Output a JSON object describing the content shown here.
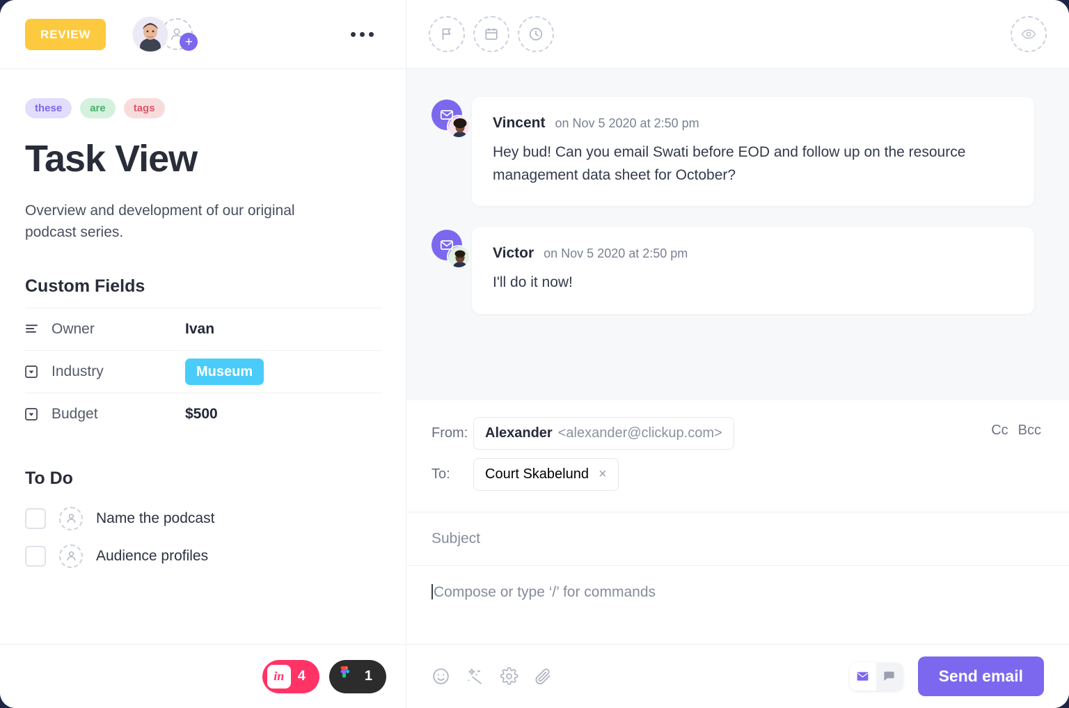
{
  "left": {
    "header": {
      "status_label": "REVIEW",
      "status_color": "#fcc93f",
      "avatar_name": "assignee-avatar",
      "add_assignee_label": "+",
      "more_menu_label": "..."
    },
    "tags": [
      {
        "label": "these",
        "bg": "#e3ddfb",
        "fg": "#7b68ee"
      },
      {
        "label": "are",
        "bg": "#d4f1dd",
        "fg": "#4caf6d"
      },
      {
        "label": "tags",
        "bg": "#f8dcdc",
        "fg": "#d9596b"
      }
    ],
    "title": "Task View",
    "description": "Overview and development of our original podcast series.",
    "custom_fields": {
      "heading": "Custom Fields",
      "rows": [
        {
          "icon": "text-lines-icon",
          "label": "Owner",
          "value": "Ivan",
          "type": "text"
        },
        {
          "icon": "dropdown-icon",
          "label": "Industry",
          "value": "Museum",
          "type": "pill",
          "pill_color": "#49ccf9"
        },
        {
          "icon": "dropdown-icon",
          "label": "Budget",
          "value": "$500",
          "type": "text"
        }
      ]
    },
    "todo": {
      "heading": "To Do",
      "items": [
        {
          "label": "Name the podcast",
          "checked": false
        },
        {
          "label": "Audience profiles",
          "checked": false
        }
      ]
    },
    "footer_badges": [
      {
        "name": "invision-badge",
        "logo": "in",
        "count": "4",
        "bg": "#ff3366"
      },
      {
        "name": "figma-badge",
        "logo": "figma",
        "count": "1",
        "bg": "#2c2c2c"
      }
    ]
  },
  "right": {
    "header_icons": [
      {
        "name": "flag-icon"
      },
      {
        "name": "calendar-icon"
      },
      {
        "name": "clock-icon"
      }
    ],
    "watch_icon": "eye-icon",
    "comments": [
      {
        "author": "Vincent",
        "time": "on Nov 5 2020 at 2:50 pm",
        "text": "Hey bud! Can you email Swati before EOD and follow up on the resource management data sheet for October?",
        "channel_icon": "envelope-icon"
      },
      {
        "author": "Victor",
        "time": "on Nov 5 2020 at 2:50 pm",
        "text": "I'll do it now!",
        "channel_icon": "envelope-icon"
      }
    ],
    "compose": {
      "from_label": "From:",
      "from_name": "Alexander",
      "from_email": "<alexander@clickup.com>",
      "to_label": "To:",
      "to_recipient": "Court Skabelund",
      "to_remove": "×",
      "cc_label": "Cc",
      "bcc_label": "Bcc",
      "subject_placeholder": "Subject",
      "body_placeholder": "Compose or type ‘/’ for commands",
      "tools": [
        {
          "name": "emoji-icon"
        },
        {
          "name": "magic-wand-icon"
        },
        {
          "name": "gear-icon"
        },
        {
          "name": "paperclip-icon"
        }
      ],
      "mode_email_icon": "envelope-icon",
      "mode_comment_icon": "chat-bubble-icon",
      "send_label": "Send email",
      "send_color": "#7b68ee"
    }
  }
}
